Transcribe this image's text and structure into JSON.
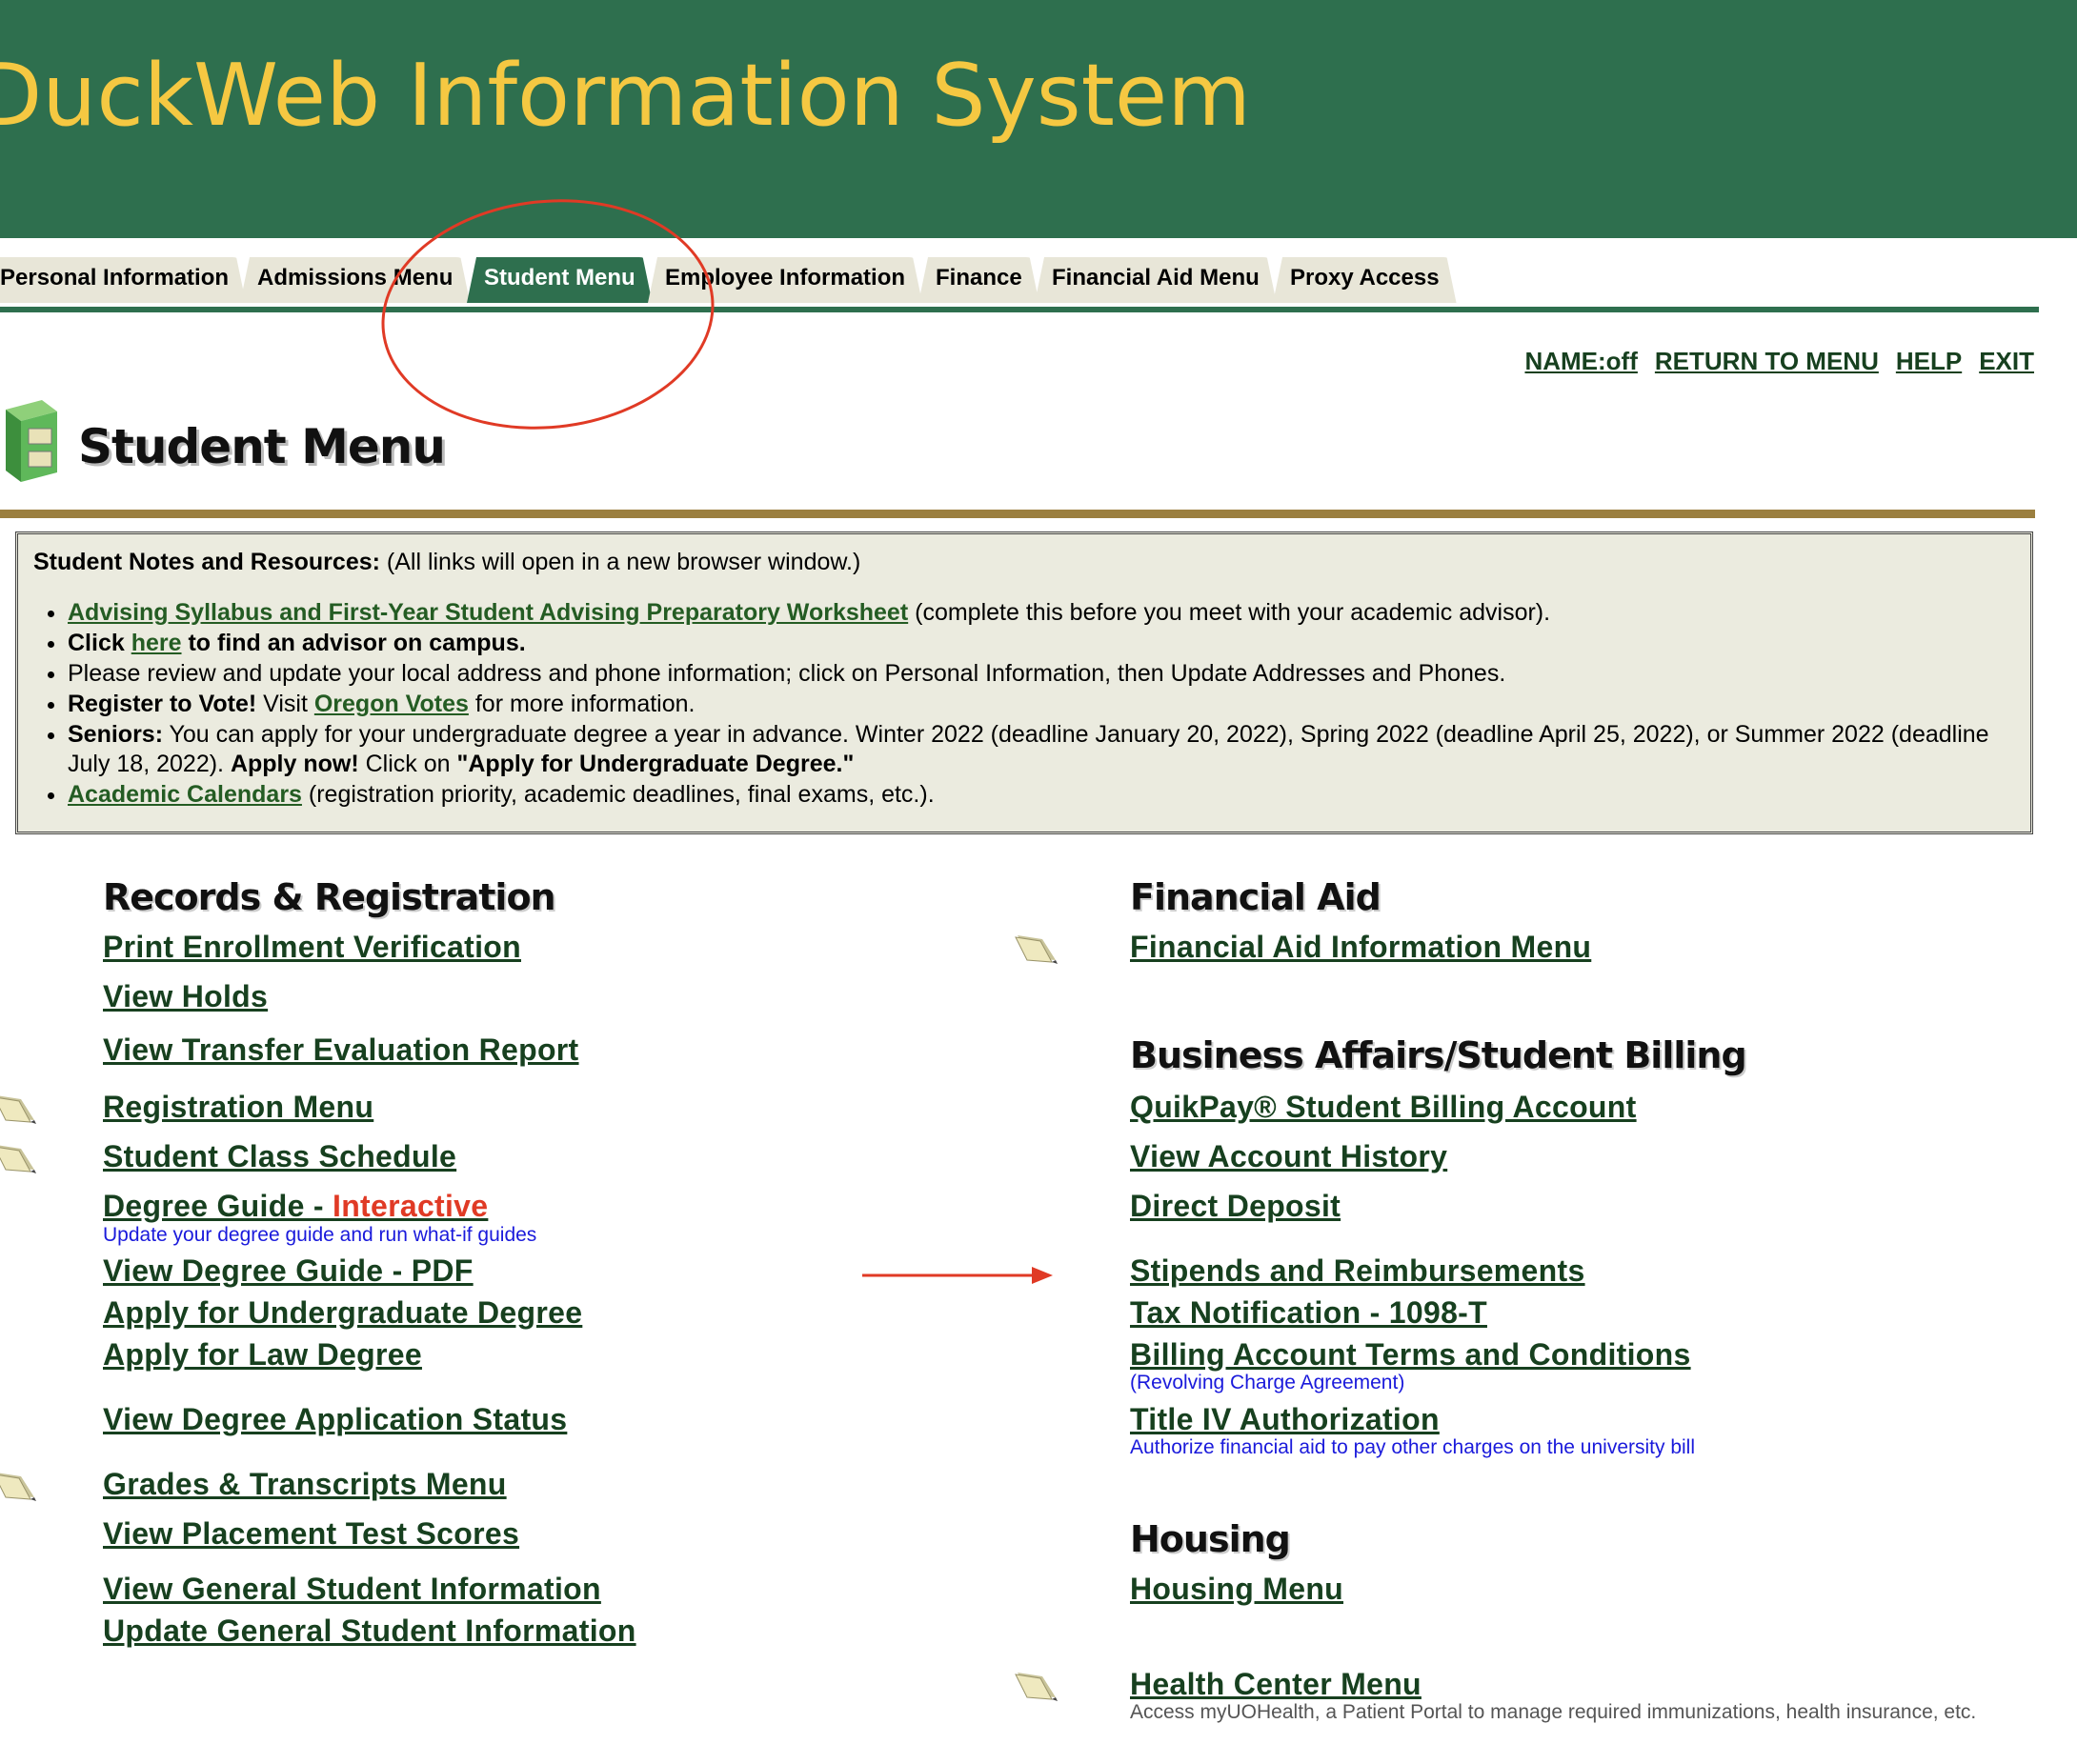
{
  "header": {
    "title": "DuckWeb Information System"
  },
  "tabs": [
    {
      "label": "Personal Information",
      "active": false
    },
    {
      "label": "Admissions Menu",
      "active": false
    },
    {
      "label": "Student Menu",
      "active": true
    },
    {
      "label": "Employee Information",
      "active": false
    },
    {
      "label": "Finance",
      "active": false
    },
    {
      "label": "Financial Aid Menu",
      "active": false
    },
    {
      "label": "Proxy Access",
      "active": false
    }
  ],
  "toplinks": {
    "name": "NAME:off",
    "return": "RETURN TO MENU",
    "help": "HELP",
    "exit": "EXIT"
  },
  "page_title": "Student Menu",
  "notes": {
    "head_bold": "Student Notes and Resources:",
    "head_rest": " (All links will open in a new browser window.)",
    "item1_link": "Advising Syllabus and First-Year Student Advising Preparatory Worksheet",
    "item1_rest": " (complete this before you meet with your academic advisor).",
    "item2_a": "Click ",
    "item2_link": "here",
    "item2_b": " to find an advisor on campus.",
    "item3": "Please review and update your local address and phone information; click on Personal Information, then Update Addresses and Phones.",
    "item4_bold": "Register to Vote!",
    "item4_a": " Visit ",
    "item4_link": "Oregon Votes",
    "item4_b": " for more information.",
    "item5_bold": "Seniors:",
    "item5_a": " You can apply for your undergraduate degree a year in advance. Winter 2022 (deadline January 20, 2022), Spring 2022 (deadline April 25, 2022), or Summer 2022 (deadline July 18, 2022). ",
    "item5_bold2": "Apply now!",
    "item5_b": " Click on ",
    "item5_bold3": "\"Apply for Undergraduate Degree.\"",
    "item6_link": "Academic Calendars",
    "item6_rest": " (registration priority, academic deadlines, final exams, etc.)."
  },
  "left": {
    "heading": "Records & Registration",
    "print_enrollment": "Print Enrollment Verification",
    "view_holds": "View Holds",
    "transfer": "View Transfer Evaluation Report",
    "registration_menu": "Registration Menu",
    "class_schedule": "Student Class Schedule",
    "degree_guide": "Degree Guide - ",
    "degree_guide_interactive": "Interactive",
    "degree_guide_sub": "Update your degree guide and run what-if guides",
    "degree_pdf": "View Degree Guide - PDF",
    "apply_ug": "Apply for Undergraduate Degree",
    "apply_law": "Apply for Law Degree",
    "degree_status": "View Degree Application Status",
    "grades_menu": "Grades & Transcripts Menu",
    "placement": "View Placement Test Scores",
    "view_general": "View General Student Information",
    "update_general": "Update General Student Information"
  },
  "right": {
    "fa_heading": "Financial Aid",
    "fa_menu": "Financial Aid Information Menu",
    "ba_heading": "Business Affairs/Student Billing",
    "quikpay": "QuikPay® Student Billing Account",
    "account_history": "View Account History",
    "direct_deposit": "Direct Deposit",
    "stipends": "Stipends and Reimbursements",
    "tax": "Tax Notification - 1098-T",
    "terms": "Billing Account Terms and Conditions",
    "terms_sub": "(Revolving Charge Agreement)",
    "title_iv": "Title IV Authorization",
    "title_iv_sub": "Authorize financial aid to pay other charges on the university bill",
    "housing_heading": "Housing",
    "housing_menu": "Housing Menu",
    "health_menu": "Health Center Menu",
    "health_sub": "Access myUOHealth, a Patient Portal to manage required immunizations, health insurance, etc."
  },
  "colors": {
    "header_green": "#2e6f4e",
    "title_gold": "#f5c842",
    "link_green": "#17401f",
    "annotation_red": "#e03a25",
    "sub_blue": "#1a1adb"
  }
}
